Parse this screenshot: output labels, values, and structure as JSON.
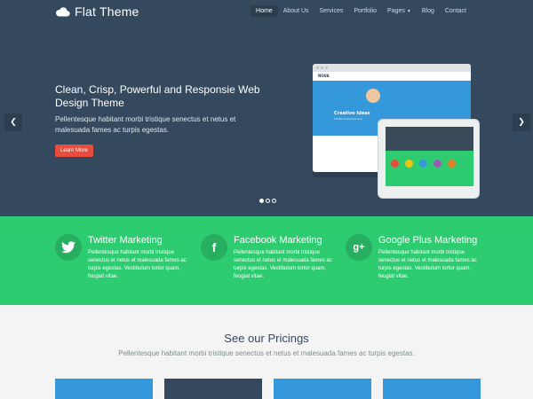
{
  "header": {
    "brand": "Flat Theme",
    "nav": [
      {
        "label": "Home",
        "active": true
      },
      {
        "label": "About Us"
      },
      {
        "label": "Services"
      },
      {
        "label": "Portfolio"
      },
      {
        "label": "Pages",
        "dropdown": true
      },
      {
        "label": "Blog"
      },
      {
        "label": "Contact"
      }
    ]
  },
  "hero": {
    "title": "Clean, Crisp, Powerful and Responsie Web Design Theme",
    "text": "Pellentesque habitant morbi tristique senectus et netus et malesuada fames ac turpis egestas.",
    "button": "Learn More",
    "mockup": {
      "brand": "NOVA",
      "banner_title": "Creative Ideas",
      "banner_sub": "Tooltal audiencia ave"
    },
    "slides": 3,
    "active_slide": 1
  },
  "services": [
    {
      "title": "Twitter Marketing",
      "icon": "twitter-icon",
      "text": "Pellentesque habitant morbi tristique senectus et netus et malesuada fames ac turpis egestas. Vestibulum tortor quam, feugiat vitae."
    },
    {
      "title": "Facebook Marketing",
      "icon": "facebook-icon",
      "text": "Pellentesque habitant morbi tristique senectus et netus et malesuada fames ac turpis egestas. Vestibulum tortor quam, feugiat vitae."
    },
    {
      "title": "Google Plus Marketing",
      "icon": "google-plus-icon",
      "text": "Pellentesque habitant morbi tristique senectus et netus et malesuada fames ac turpis egestas. Vestibulum tortor quam, feugiat vitae."
    }
  ],
  "pricing": {
    "title": "See our Pricings",
    "subtitle": "Pellentesque habitant morbi tristique senectus et netus et malesuada fames ac turpis egestas."
  },
  "colors": {
    "dark": "#34495e",
    "green": "#2ecc71",
    "blue": "#3498db",
    "red": "#e74c3c"
  }
}
